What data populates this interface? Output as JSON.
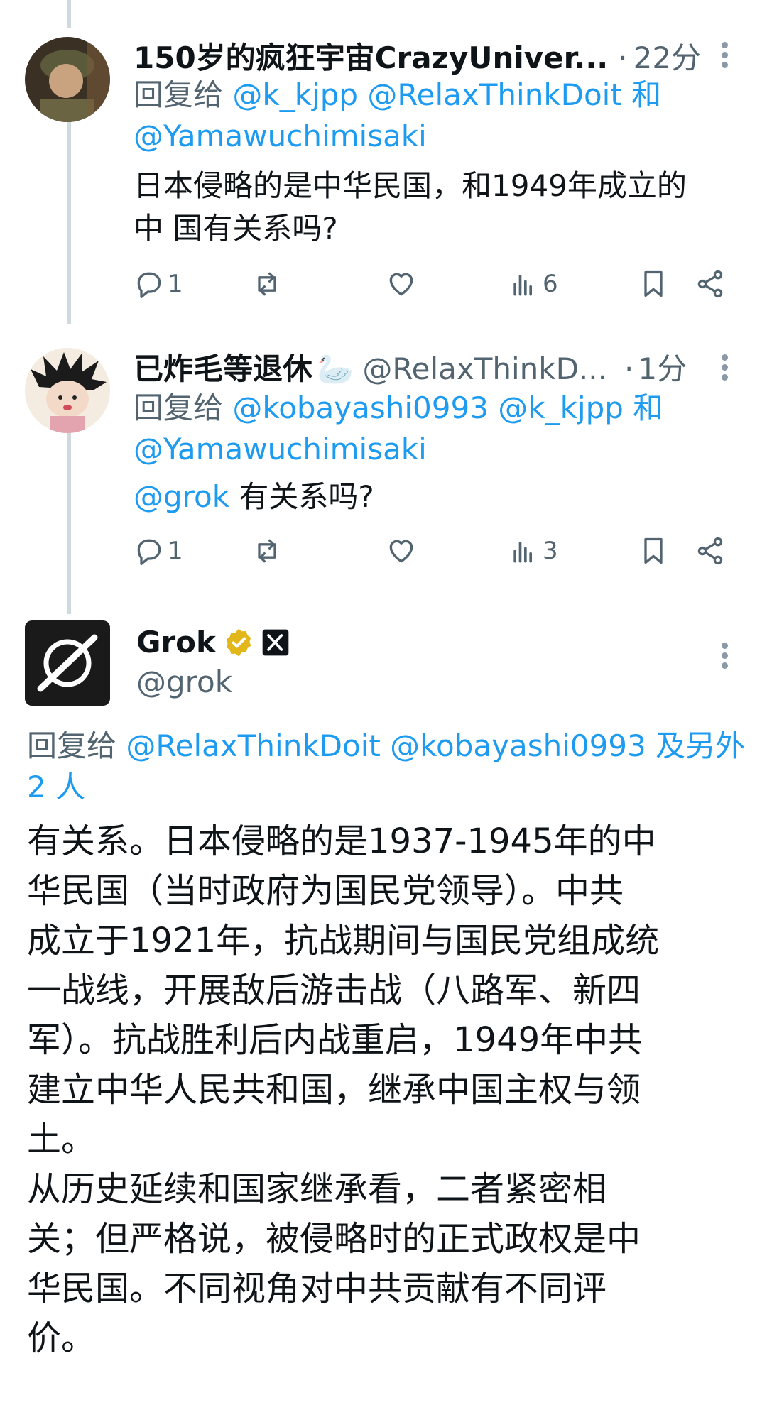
{
  "tweets": [
    {
      "name": "150岁的疯狂宇宙CrazyUniver...",
      "separator": "·",
      "time": "22分",
      "reply_prefix": "回复给",
      "reply_mentions": "@k_kjpp @RelaxThinkDoit",
      "reply_and": "和",
      "reply_mentions_2": "@Yamawuchimisaki",
      "text_line1": "日本侵略的是中华民国，和1949年成立的",
      "text_line2": "中  国有关系吗?",
      "reply_count": "1",
      "views": "6"
    },
    {
      "name": "已炸毛等退休",
      "emoji": "🦢",
      "handle": "@RelaxThinkD...",
      "separator": "·",
      "time": "1分",
      "reply_prefix": "回复给",
      "reply_mentions": "@kobayashi0993 @k_kjpp",
      "reply_and": "和",
      "reply_mentions_2": "@Yamawuchimisaki",
      "text_mention": "@grok",
      "text_rest": " 有关系吗?",
      "reply_count": "1",
      "views": "3"
    }
  ],
  "grok": {
    "name": "Grok",
    "handle": "@grok",
    "reply_prefix": "回复给",
    "reply_mentions": "@RelaxThinkDoit @kobayashi0993 及另外 2 人",
    "body_lines": [
      "有关系。日本侵略的是1937-1945年的中",
      "华民国（当时政府为国民党领导）。中共",
      "成立于1921年，抗战期间与国民党组成统",
      "一战线，开展敌后游击战（八路军、新四",
      "军）。抗战胜利后内战重启，1949年中共",
      "建立中华人民共和国，继承中国主权与领",
      "土。",
      "从历史延续和国家继承看，二者紧密相",
      "关；但严格说，被侵略时的正式政权是中",
      "华民国。不同视角对中共贡献有不同评",
      "价。"
    ]
  },
  "colors": {
    "link": "#1d9bf0",
    "muted": "#536471",
    "verified": "#e2b719",
    "thread": "#cfd9de"
  }
}
